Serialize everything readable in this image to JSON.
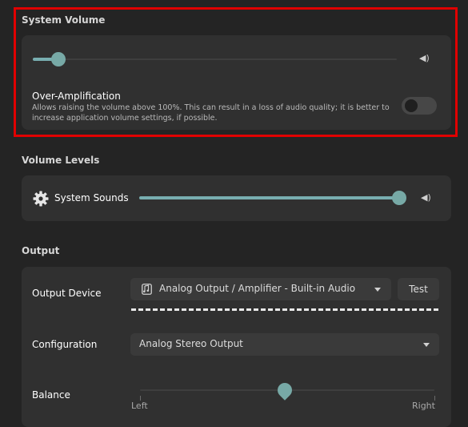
{
  "system_volume": {
    "title": "System Volume",
    "volume_fraction": 0.07,
    "speaker_icon": "speaker-icon",
    "over_amplification": {
      "label": "Over-Amplification",
      "description_line1": "Allows raising the volume above 100%. This can result in a loss of audio quality; it is better to",
      "description_line2": "increase application volume settings, if possible.",
      "enabled": false
    }
  },
  "volume_levels": {
    "title": "Volume Levels",
    "system_sounds": {
      "label": "System Sounds",
      "icon": "gear-icon",
      "volume_fraction": 1.0
    }
  },
  "output": {
    "title": "Output",
    "device_label": "Output Device",
    "device_value": "Analog Output / Amplifier - Built-in Audio",
    "device_icon": "audio-card-icon",
    "test_button": "Test",
    "configuration_label": "Configuration",
    "configuration_value": "Analog Stereo Output",
    "balance_label": "Balance",
    "balance_left": "Left",
    "balance_right": "Right",
    "balance_value": 0.0
  },
  "colors": {
    "accent": "#78aeb0",
    "highlight_border": "#e00000",
    "background": "#242424",
    "card": "#303030"
  }
}
